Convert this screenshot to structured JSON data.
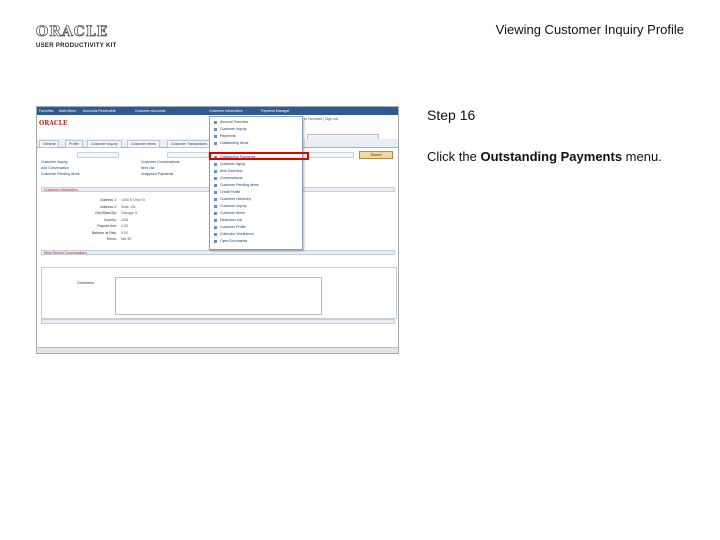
{
  "logo": {
    "brand": "ORACLE",
    "tagline": "USER PRODUCTIVITY KIT"
  },
  "header": {
    "title": "Viewing Customer Inquiry Profile"
  },
  "step": {
    "title": "Step 16",
    "instruction_prefix": "Click the ",
    "instruction_target": "Outstanding Payments",
    "instruction_suffix": " menu."
  },
  "screenshot": {
    "nav_menus": [
      "Favorites",
      "Main Menu",
      "Accounts Receivable",
      "Customer Accounts",
      "Customer Information",
      "Payment Manager"
    ],
    "global_links": "Home | Worklist | Add to Favorites | Sign out",
    "search_label": "Search",
    "tabs": [
      "General",
      "Profile",
      "Customer Inquiry",
      "Customer Items",
      "Customer Transactions"
    ],
    "left_links": [
      "Customer Inquiry",
      "Add Conversation",
      "Customer Pending Items"
    ],
    "mid_links": [
      "Customer Conversations",
      "Item List",
      "Unapplied Payments"
    ],
    "section_bar": "Customer Information",
    "conversation_bar": "Most Recent Conversations",
    "comments_label": "Comments",
    "form_labels": [
      "Address 1:",
      "Address 2:",
      "City/State/Zip:",
      "Country:",
      "Dispute Amt:",
      "Balance at Risk:",
      "Terms:"
    ],
    "form_values": [
      "1400 E Ohio St",
      "Suite 101",
      "Chicago IL",
      "USA",
      "0.00",
      "0.00",
      "Net 30"
    ],
    "dropdown_items": [
      "Account Overview",
      "Customer Inquiry",
      "Payments",
      "Outstanding Items",
      "Outstanding Payments",
      "Customer Aging",
      "Item Overview",
      "Conversations",
      "Customer Pending Items",
      "Credit Profile",
      "Customer Hierarchy",
      "Customer Inquiry",
      "Customer Items",
      "Deduction List",
      "Customer Profile",
      "Collection Workbench",
      "Open Documents"
    ]
  }
}
